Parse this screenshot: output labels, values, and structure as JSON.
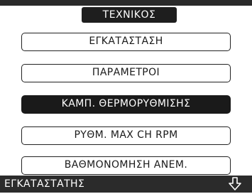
{
  "header": {
    "title": "ΤΕΧΝΙΚΟΣ"
  },
  "menu": {
    "items": [
      {
        "label": "ΕΓΚΑΤΑΣΤΑΣΗ",
        "selected": false
      },
      {
        "label": "ΠΑΡΑΜΕΤΡΟΙ",
        "selected": false
      },
      {
        "label": "ΚΑΜΠ. ΘΕΡΜΟΡΥΘΜΙΣΗΣ",
        "selected": true
      },
      {
        "label": "ΡΥΘΜ. MAX CH RPM",
        "selected": false
      },
      {
        "label": "ΒΑΘΜΟΝΟΜΗΣΗ ΑΝΕΜ.",
        "selected": false
      }
    ]
  },
  "footer": {
    "label": "ΕΓΚΑΤΑΣΤΑΤΗΣ",
    "nav_icon": "down-arrow-icon"
  },
  "colors": {
    "background": "#ffffff",
    "dark": "#1a1a1a",
    "bar": "#2b2b2b",
    "text_on_dark": "#ffffff"
  }
}
